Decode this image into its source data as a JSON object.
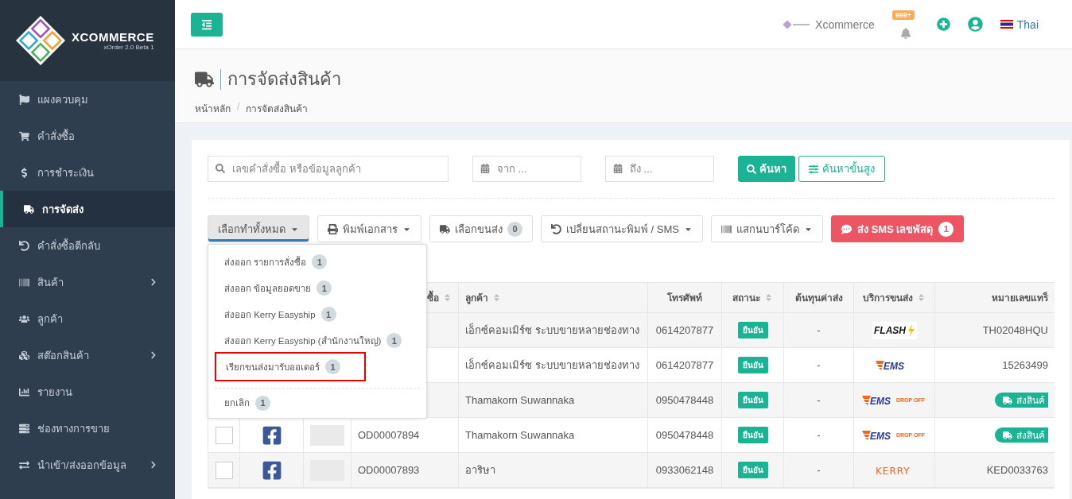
{
  "brand": {
    "name": "XCOMMERCE",
    "version": "xOrder 2.0 Beta 1"
  },
  "sidebar": {
    "items": [
      {
        "label": "แผงควบคุม",
        "selected": false,
        "has_submenu": false
      },
      {
        "label": "คำสั่งซื้อ",
        "selected": false,
        "has_submenu": false
      },
      {
        "label": "การชำระเงิน",
        "selected": false,
        "has_submenu": false
      },
      {
        "label": "การจัดส่ง",
        "selected": true,
        "has_submenu": false
      },
      {
        "label": "คำสั่งซื้อตีกลับ",
        "selected": false,
        "has_submenu": false
      },
      {
        "label": "สินค้า",
        "selected": false,
        "has_submenu": true
      },
      {
        "label": "ลูกค้า",
        "selected": false,
        "has_submenu": false
      },
      {
        "label": "สต๊อกสินค้า",
        "selected": false,
        "has_submenu": true
      },
      {
        "label": "รายงาน",
        "selected": false,
        "has_submenu": false
      },
      {
        "label": "ช่องทางการขาย",
        "selected": false,
        "has_submenu": false
      },
      {
        "label": "นำเข้า/ส่งออกข้อมูล",
        "selected": false,
        "has_submenu": true
      }
    ]
  },
  "topbar": {
    "shop": "Xcommerce",
    "notifications": "999+",
    "language": "Thai"
  },
  "page": {
    "title": "การจัดส่งสินค้า",
    "breadcrumb": [
      "หน้าหลัก",
      "การจัดส่งสินค้า"
    ],
    "breadcrumb_separator": "/"
  },
  "filters": {
    "search": {
      "placeholder": "เลขคำสั่งซื้อ หรือข้อมูลลูกค้า"
    },
    "date_from": {
      "placeholder": "จาก ..."
    },
    "date_to": {
      "placeholder": "ถึง ..."
    },
    "search_button": "ค้นหา",
    "advanced_button": "ค้นหาขั้นสูง"
  },
  "toolbar": [
    {
      "kind": "menu",
      "label": "เลือกทำทั้งหมด",
      "expanded": true
    },
    {
      "kind": "menu",
      "label": "พิมพ์เอกสาร",
      "expanded": false
    },
    {
      "kind": "count",
      "label": "เลือกขนส่ง",
      "count": "0"
    },
    {
      "kind": "menu",
      "label": "เปลี่ยนสถานะพิมพ์ / SMS",
      "expanded": false
    },
    {
      "kind": "menu",
      "label": "แสกนบาร์โค้ด",
      "expanded": false
    },
    {
      "kind": "danger",
      "label": "ส่ง SMS เลขพัสดุ",
      "count": "1"
    }
  ],
  "bulk_menu": {
    "items": [
      {
        "label": "ส่งออก รายการสั่งซื้อ",
        "count": "1",
        "highlighted": false,
        "divider_before": false
      },
      {
        "label": "ส่งออก ข้อมูลยอดขาย",
        "count": "1",
        "highlighted": false,
        "divider_before": false
      },
      {
        "label": "ส่งออก Kerry Easyship",
        "count": "1",
        "highlighted": false,
        "divider_before": false
      },
      {
        "label": "ส่งออก Kerry Easyship (สำนักงานใหญ่)",
        "count": "1",
        "highlighted": false,
        "divider_before": false
      },
      {
        "label": "เรียกขนส่งมารับออเดอร์",
        "count": "1",
        "highlighted": true,
        "divider_before": false
      },
      {
        "label": "ยกเลิก",
        "count": "1",
        "highlighted": false,
        "divider_before": true
      }
    ]
  },
  "table": {
    "columns": [
      {
        "label": "ซื้อ",
        "sortable": true
      },
      {
        "label": "ลูกค้า",
        "sortable": true
      },
      {
        "label": "โทรศัพท์",
        "sortable": false
      },
      {
        "label": "สถานะ",
        "sortable": true
      },
      {
        "label": "ต้นทุนค่าส่ง",
        "sortable": false
      },
      {
        "label": "บริการขนส่ง",
        "sortable": true
      },
      {
        "label": "หมายเลขแทร็",
        "sortable": false
      }
    ],
    "rows": [
      {
        "customer": "เอ็กซ์คอมเมิร์ซ ระบบขายหลายช่องทาง",
        "phone": "0614207877",
        "status": "ยืนยัน",
        "cost": "-",
        "carrier": {
          "kind": "flash",
          "text": "FLASH"
        },
        "tracking": {
          "kind": "text",
          "text": "TH02048HQU"
        }
      },
      {
        "customer": "เอ็กซ์คอมเมิร์ซ ระบบขายหลายช่องทาง",
        "phone": "0614207877",
        "status": "ยืนยัน",
        "cost": "-",
        "carrier": {
          "kind": "ems",
          "text": "EMS"
        },
        "tracking": {
          "kind": "text",
          "text": "15263499"
        }
      },
      {
        "customer": "Thamakorn Suwannaka",
        "phone": "0950478448",
        "status": "ยืนยัน",
        "cost": "-",
        "carrier": {
          "kind": "ems_drop",
          "text": "EMS",
          "sub": "DROP OFF"
        },
        "tracking": {
          "kind": "button",
          "text": "ส่งสินค้"
        }
      },
      {
        "checked": false,
        "channel": {
          "kind": "facebook"
        },
        "order_no": "OD00007894",
        "customer": "Thamakorn Suwannaka",
        "phone": "0950478448",
        "status": "ยืนยัน",
        "cost": "-",
        "carrier": {
          "kind": "ems_drop",
          "text": "EMS",
          "sub": "DROP OFF"
        },
        "tracking": {
          "kind": "button",
          "text": "ส่งสินค้"
        }
      },
      {
        "checked": false,
        "channel": {
          "kind": "facebook"
        },
        "order_no": "OD00007893",
        "customer": "อาริษา",
        "phone": "0933062148",
        "status": "ยืนยัน",
        "cost": "-",
        "carrier": {
          "kind": "kerry",
          "text": "KERRY"
        },
        "tracking": {
          "kind": "text",
          "text": "KED0033763"
        }
      }
    ]
  }
}
